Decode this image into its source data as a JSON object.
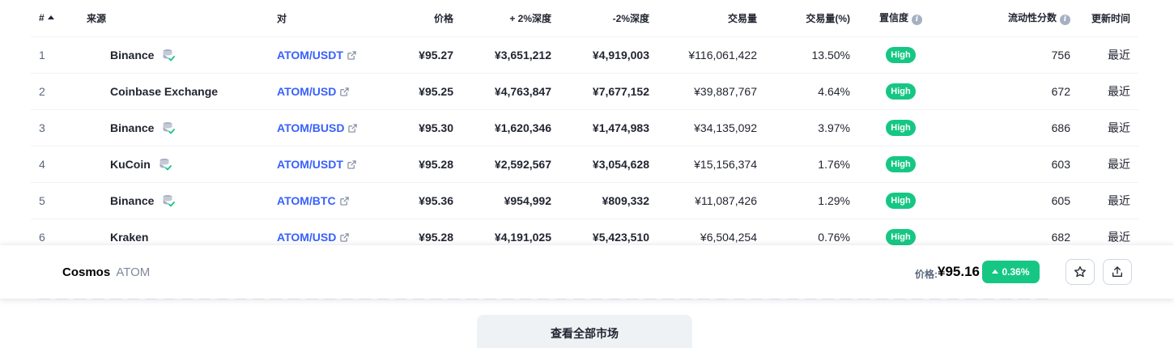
{
  "table": {
    "headers": {
      "rank": "#",
      "source": "来源",
      "pair": "对",
      "price": "价格",
      "depth_plus": "+ 2%深度",
      "depth_minus": "-2%深度",
      "volume": "交易量",
      "volume_pct": "交易量(%)",
      "confidence": "置信度",
      "liquidity": "流动性分数",
      "updated": "更新时间"
    },
    "rows": [
      {
        "rank": "1",
        "source": "Binance",
        "has_db_icon": true,
        "pair": "ATOM/USDT",
        "price": "¥95.27",
        "depth_plus": "¥3,651,212",
        "depth_minus": "¥4,919,003",
        "volume": "¥116,061,422",
        "volume_pct": "13.50%",
        "confidence": "High",
        "liquidity": "756",
        "updated": "最近"
      },
      {
        "rank": "2",
        "source": "Coinbase Exchange",
        "has_db_icon": false,
        "pair": "ATOM/USD",
        "price": "¥95.25",
        "depth_plus": "¥4,763,847",
        "depth_minus": "¥7,677,152",
        "volume": "¥39,887,767",
        "volume_pct": "4.64%",
        "confidence": "High",
        "liquidity": "672",
        "updated": "最近"
      },
      {
        "rank": "3",
        "source": "Binance",
        "has_db_icon": true,
        "pair": "ATOM/BUSD",
        "price": "¥95.30",
        "depth_plus": "¥1,620,346",
        "depth_minus": "¥1,474,983",
        "volume": "¥34,135,092",
        "volume_pct": "3.97%",
        "confidence": "High",
        "liquidity": "686",
        "updated": "最近"
      },
      {
        "rank": "4",
        "source": "KuCoin",
        "has_db_icon": true,
        "pair": "ATOM/USDT",
        "price": "¥95.28",
        "depth_plus": "¥2,592,567",
        "depth_minus": "¥3,054,628",
        "volume": "¥15,156,374",
        "volume_pct": "1.76%",
        "confidence": "High",
        "liquidity": "603",
        "updated": "最近"
      },
      {
        "rank": "5",
        "source": "Binance",
        "has_db_icon": true,
        "pair": "ATOM/BTC",
        "price": "¥95.36",
        "depth_plus": "¥954,992",
        "depth_minus": "¥809,332",
        "volume": "¥11,087,426",
        "volume_pct": "1.29%",
        "confidence": "High",
        "liquidity": "605",
        "updated": "最近"
      },
      {
        "rank": "6",
        "source": "Kraken",
        "has_db_icon": false,
        "pair": "ATOM/USD",
        "price": "¥95.28",
        "depth_plus": "¥4,191,025",
        "depth_minus": "¥5,423,510",
        "volume": "¥6,504,254",
        "volume_pct": "0.76%",
        "confidence": "High",
        "liquidity": "682",
        "updated": "最近"
      }
    ]
  },
  "sticky_bar": {
    "coin_name": "Cosmos",
    "coin_symbol": "ATOM",
    "price_label": "价格:",
    "price": "¥95.16",
    "change": "0.36%",
    "change_direction": "up"
  },
  "view_all_label": "查看全部市场",
  "colors": {
    "accent_link": "#3861fb",
    "positive": "#16c784",
    "muted_text": "#58667e",
    "border": "#eff2f5"
  },
  "icons": [
    "sort-asc-icon",
    "database-verified-icon",
    "external-link-icon",
    "info-icon",
    "star-icon",
    "share-icon",
    "caret-up-icon"
  ]
}
